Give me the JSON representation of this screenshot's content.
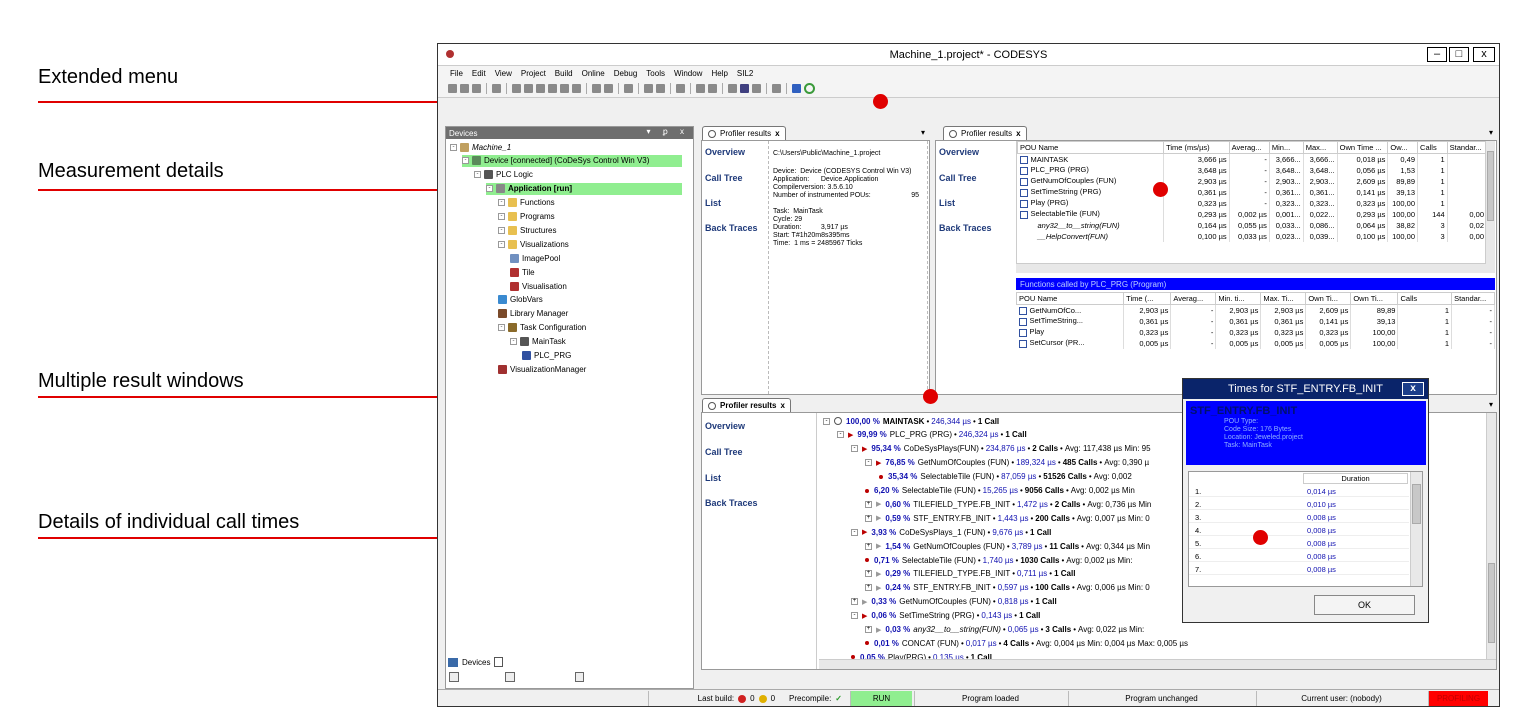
{
  "callouts": {
    "extended_menu": "Extended menu",
    "measurement_details": "Measurement details",
    "multiple_result_windows": "Multiple result windows",
    "individual_call_times": "Details of individual call times"
  },
  "colors": {
    "callout_red": "#e00000",
    "highlight_green": "#90ee90",
    "profiler_blue": "#0000ff",
    "status_run_green": "#90ee90",
    "status_profiling_red": "#ff0000"
  },
  "window": {
    "title": "Machine_1.project* - CODESYS",
    "minimize": "–",
    "maximize": "□",
    "close": "x"
  },
  "menu": [
    "File",
    "Edit",
    "View",
    "Project",
    "Build",
    "Online",
    "Debug",
    "Tools",
    "Window",
    "Help",
    "SIL2"
  ],
  "devices": {
    "title": "Devices",
    "controls": "▾ ꝑ x",
    "tree": [
      {
        "label": "Machine_1",
        "icon": "project-icon"
      },
      {
        "label": "Device [connected] (CoDeSys Control Win V3)",
        "icon": "device-icon"
      },
      {
        "label": "PLC Logic",
        "icon": "plc-logic-icon"
      },
      {
        "label": "Application [run]",
        "icon": "application-icon"
      },
      {
        "label": "Functions",
        "icon": "folder-icon"
      },
      {
        "label": "Programs",
        "icon": "folder-icon"
      },
      {
        "label": "Structures",
        "icon": "folder-icon"
      },
      {
        "label": "Visualizations",
        "icon": "folder-icon"
      },
      {
        "label": "ImagePool",
        "icon": "imagepool-icon"
      },
      {
        "label": "Tile",
        "icon": "visualization-icon"
      },
      {
        "label": "Visualisation",
        "icon": "visualization-icon"
      },
      {
        "label": "GlobVars",
        "icon": "globvars-icon"
      },
      {
        "label": "Library Manager",
        "icon": "library-icon"
      },
      {
        "label": "Task Configuration",
        "icon": "task-config-icon"
      },
      {
        "label": "MainTask",
        "icon": "task-icon"
      },
      {
        "label": "PLC_PRG",
        "icon": "pou-icon"
      },
      {
        "label": "VisualizationManager",
        "icon": "vis-manager-icon"
      }
    ],
    "bottom_tab": "Devices"
  },
  "profiler_tab_label": "Profiler results",
  "nav": {
    "overview": "Overview",
    "call_tree": "Call Tree",
    "list": "List",
    "back_traces": "Back Traces"
  },
  "measurement_details": {
    "path": "C:\\Users\\Public\\Machine_1.project",
    "device": "Device:  Device (CODESYS Control Win V3)",
    "application": "Application:      Device.Application",
    "compiler": "Compilerversion: 3.5.6.10",
    "instrumented": "Number of instrumented POUs:",
    "instrumented_value": "95",
    "task": "Task:  MainTask",
    "cycle": "Cycle: 29",
    "duration": "Duration:          3,917 µs",
    "start": "Start: T#1h20m8s395ms",
    "time": "Time:  1 ms = 2485967 Ticks"
  },
  "list_table": {
    "headers": [
      "POU Name",
      "Time (ms/µs)",
      "Averag...",
      "Min...",
      "Max...",
      "Own Time ...",
      "Ow...",
      "Calls",
      "Standar..."
    ],
    "rows": [
      [
        "MAINTASK",
        "3,666 µs",
        "-",
        "3,666...",
        "3,666...",
        "0,018 µs",
        "0,49",
        "1",
        ""
      ],
      [
        "PLC_PRG (PRG)",
        "3,648 µs",
        "-",
        "3,648...",
        "3,648...",
        "0,056 µs",
        "1,53",
        "1",
        ""
      ],
      [
        "GetNumOfCouples (FUN)",
        "2,903 µs",
        "-",
        "2,903...",
        "2,903...",
        "2,609 µs",
        "89,89",
        "1",
        ""
      ],
      [
        "SetTimeString (PRG)",
        "0,361 µs",
        "-",
        "0,361...",
        "0,361...",
        "0,141 µs",
        "39,13",
        "1",
        ""
      ],
      [
        "Play (PRG)",
        "0,323 µs",
        "-",
        "0,323...",
        "0,323...",
        "0,323 µs",
        "100,00",
        "1",
        ""
      ],
      [
        "SelectableTile (FUN)",
        "0,293 µs",
        "0,002 µs",
        "0,001...",
        "0,022...",
        "0,293 µs",
        "100,00",
        "144",
        "0,00"
      ],
      [
        "any32__to__string(FUN)",
        "0,164 µs",
        "0,055 µs",
        "0,033...",
        "0,086...",
        "0,064 µs",
        "38,82",
        "3",
        "0,02"
      ],
      [
        "__HelpConvert(FUN)",
        "0,100 µs",
        "0,033 µs",
        "0,023...",
        "0,039...",
        "0,100 µs",
        "100,00",
        "3",
        "0,00"
      ]
    ]
  },
  "called_by": {
    "title": "Functions called by PLC_PRG (Program)",
    "headers": [
      "POU Name",
      "Time (...",
      "Averag...",
      "Min. ti...",
      "Max. Ti...",
      "Own Ti...",
      "Own Ti...",
      "Calls",
      "Standar..."
    ],
    "rows": [
      [
        "GetNumOfCo...",
        "2,903 µs",
        "-",
        "2,903 µs",
        "2,903 µs",
        "2,609 µs",
        "89,89",
        "1",
        "-"
      ],
      [
        "SetTimeString...",
        "0,361 µs",
        "-",
        "0,361 µs",
        "0,361 µs",
        "0,141 µs",
        "39,13",
        "1",
        "-"
      ],
      [
        "Play",
        "0,323 µs",
        "-",
        "0,323 µs",
        "0,323 µs",
        "0,323 µs",
        "100,00",
        "1",
        "-"
      ],
      [
        "SetCursor (PR...",
        "0,005 µs",
        "-",
        "0,005 µs",
        "0,005 µs",
        "0,005 µs",
        "100,00",
        "1",
        "-"
      ]
    ]
  },
  "call_tree": [
    {
      "indent": 0,
      "kind": "tog-clock",
      "pct": "100,00 %",
      "name": "MAINTASK",
      "time": "246,344 µs",
      "calls": "1 Call",
      "extra": ""
    },
    {
      "indent": 1,
      "kind": "tog-arrow",
      "pct": "99,99 %",
      "name": "PLC_PRG (PRG)",
      "time": "246,324 µs",
      "calls": "1 Call",
      "extra": ""
    },
    {
      "indent": 2,
      "kind": "tog-arrow",
      "pct": "95,34 %",
      "name": "CoDeSysPlays(FUN)",
      "time": "234,876 µs",
      "calls": "2 Calls",
      "extra": "Avg: 117,438 µs Min: 95"
    },
    {
      "indent": 3,
      "kind": "tog-arrow",
      "pct": "76,85 %",
      "name": "GetNumOfCouples (FUN)",
      "time": "189,324 µs",
      "calls": "485 Calls",
      "extra": "Avg: 0,390 µ"
    },
    {
      "indent": 4,
      "kind": "bullet",
      "pct": "35,34 %",
      "name": "SelectableTile (FUN)",
      "time": "87,059 µs",
      "calls": "51526 Calls",
      "extra": "Avg: 0,002"
    },
    {
      "indent": 3,
      "kind": "bullet",
      "pct": "6,20 %",
      "name": "SelectableTile (FUN)",
      "time": "15,265 µs",
      "calls": "9056 Calls",
      "extra": "Avg: 0,002 µs Min"
    },
    {
      "indent": 3,
      "kind": "plus-arrow",
      "pct": "0,60 %",
      "name": "TILEFIELD_TYPE.FB_INIT",
      "time": "1,472 µs",
      "calls": "2 Calls",
      "extra": "Avg: 0,736 µs Min"
    },
    {
      "indent": 3,
      "kind": "plus-arrow",
      "pct": "0,59 %",
      "name": "STF_ENTRY.FB_INIT",
      "time": "1,443 µs",
      "calls": "200 Calls",
      "extra": "Avg: 0,007 µs Min: 0"
    },
    {
      "indent": 2,
      "kind": "tog-arrow",
      "pct": "3,93 %",
      "name": "CoDeSysPlays_1 (FUN)",
      "time": "9,676 µs",
      "calls": "1 Call",
      "extra": ""
    },
    {
      "indent": 3,
      "kind": "plus-arrow",
      "pct": "1,54 %",
      "name": "GetNumOfCouples (FUN)",
      "time": "3,789 µs",
      "calls": "11 Calls",
      "extra": "Avg: 0,344 µs Min"
    },
    {
      "indent": 3,
      "kind": "bullet",
      "pct": "0,71 %",
      "name": "SelectableTile (FUN)",
      "time": "1,740 µs",
      "calls": "1030 Calls",
      "extra": "Avg: 0,002 µs Min:"
    },
    {
      "indent": 3,
      "kind": "plus-arrow",
      "pct": "0,29 %",
      "name": "TILEFIELD_TYPE.FB_INIT",
      "time": "0,711 µs",
      "calls": "1 Call",
      "extra": ""
    },
    {
      "indent": 3,
      "kind": "plus-arrow",
      "pct": "0,24 %",
      "name": "STF_ENTRY.FB_INIT",
      "time": "0,597 µs",
      "calls": "100 Calls",
      "extra": "Avg: 0,006 µs Min: 0"
    },
    {
      "indent": 2,
      "kind": "plus-arrow",
      "pct": "0,33 %",
      "name": "GetNumOfCouples (FUN)",
      "time": "0,818 µs",
      "calls": "1 Call",
      "extra": ""
    },
    {
      "indent": 2,
      "kind": "tog-arrow",
      "pct": "0,06 %",
      "name": "SetTimeString (PRG)",
      "time": "0,143 µs",
      "calls": "1 Call",
      "extra": ""
    },
    {
      "indent": 3,
      "kind": "plus-arrow",
      "pct": "0,03 %",
      "name": "any32__to__string(FUN)",
      "time": "0,065 µs",
      "calls": "3 Calls",
      "extra": "Avg: 0,022 µs Min:"
    },
    {
      "indent": 3,
      "kind": "bullet",
      "pct": "0,01 %",
      "name": "CONCAT (FUN)",
      "time": "0,017 µs",
      "calls": "4 Calls",
      "extra": "Avg: 0,004 µs Min: 0,004 µs Max: 0,005 µs"
    },
    {
      "indent": 2,
      "kind": "bullet",
      "pct": "0,05 %",
      "name": "Play(PRG)",
      "time": "0,135 µs",
      "calls": "1 Call",
      "extra": ""
    }
  ],
  "dialog": {
    "title": "Times for STF_ENTRY.FB_INIT",
    "close": "x",
    "name": "STF_ENTRY.FB_INIT",
    "pou_type": "POU Type:",
    "code_size": "Code Size: 176 Bytes",
    "location": "Location: Jeweled.project",
    "task": "Task: MainTask",
    "column": "Duration",
    "rows": [
      [
        "1.",
        "0,014 µs"
      ],
      [
        "2.",
        "0,010 µs"
      ],
      [
        "3.",
        "0,008 µs"
      ],
      [
        "4.",
        "0,008 µs"
      ],
      [
        "5.",
        "0,008 µs"
      ],
      [
        "6.",
        "0,008 µs"
      ],
      [
        "7.",
        "0,008 µs"
      ]
    ],
    "ok": "OK"
  },
  "status": {
    "last_build": "Last build:",
    "errors": "0",
    "warnings": "0",
    "precompile": "Precompile:",
    "run": "RUN",
    "program_loaded": "Program loaded",
    "program_unchanged": "Program unchanged",
    "user": "Current user: (nobody)",
    "profiling": "PROFILING"
  }
}
